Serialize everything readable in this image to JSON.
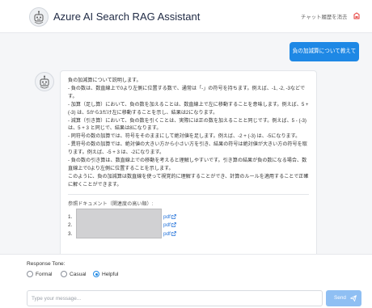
{
  "header": {
    "title": "Azure AI Search RAG Assistant",
    "clear_label": "チャット履歴を消去",
    "logo_icon": "robot-icon",
    "clear_icon": "clear-icon"
  },
  "chat": {
    "user_message": "負の加減算について教えて",
    "bot_avatar_icon": "robot-icon",
    "bot_lines": [
      "負の加減算について説明します。",
      "- 負の数は、数直線上で0より左側に位置する数で、通常は「-」の符号を持ちます。例えば、-1, -2, -3などです。",
      "- 加算（足し算）において、負の数を加えることは、数直線上で左に移動することを意味します。例えば、5 + (-3) は、5から3だけ左に移動することを示し、結果は2になります。",
      "- 減算（引き算）において、負の数を引くことは、実際には正の数を加えることと同じです。例えば、5 - (-3) は、5 + 3 と同じで、結果は8になります。",
      "- 同符号の数の加算では、符号をそのままにして絶対値を足します。例えば、-2 + (-3) は、-5になります。",
      "- 異符号の数の加算では、絶対値の大きい方から小さい方を引き、結果の符号は絶対値が大きい方の符号を取ります。例えば、-5 + 3 は、-2になります。",
      "- 負の数の引き算は、数直線上での移動を考えると理解しやすいです。引き算の結果が負の数になる場合、数直線上で0より左側に位置することを示します。",
      "このように、負の加減算は数直線を使って視覚的に理解することができ、計算のルールを適用することで正確に解くことができます。"
    ],
    "refs_label": "参照ドキュメント（関連度の高い順）:",
    "refs": [
      {
        "num": "1.",
        "link": "pdf"
      },
      {
        "num": "2.",
        "link": "pdf"
      },
      {
        "num": "3.",
        "link": "pdf"
      }
    ],
    "link_icon": "external-link-icon"
  },
  "footer": {
    "tone_label": "Response Tone:",
    "tones": [
      {
        "label": "Formal",
        "selected": false
      },
      {
        "label": "Casual",
        "selected": false
      },
      {
        "label": "Helpful",
        "selected": true
      }
    ],
    "input_placeholder": "Type your message...",
    "send_label": "Send",
    "send_icon": "paper-plane-icon"
  },
  "colors": {
    "accent": "#1e88e5",
    "send_disabled": "#8fbff3",
    "link": "#1e6fd9",
    "clear_icon": "#e53935"
  }
}
